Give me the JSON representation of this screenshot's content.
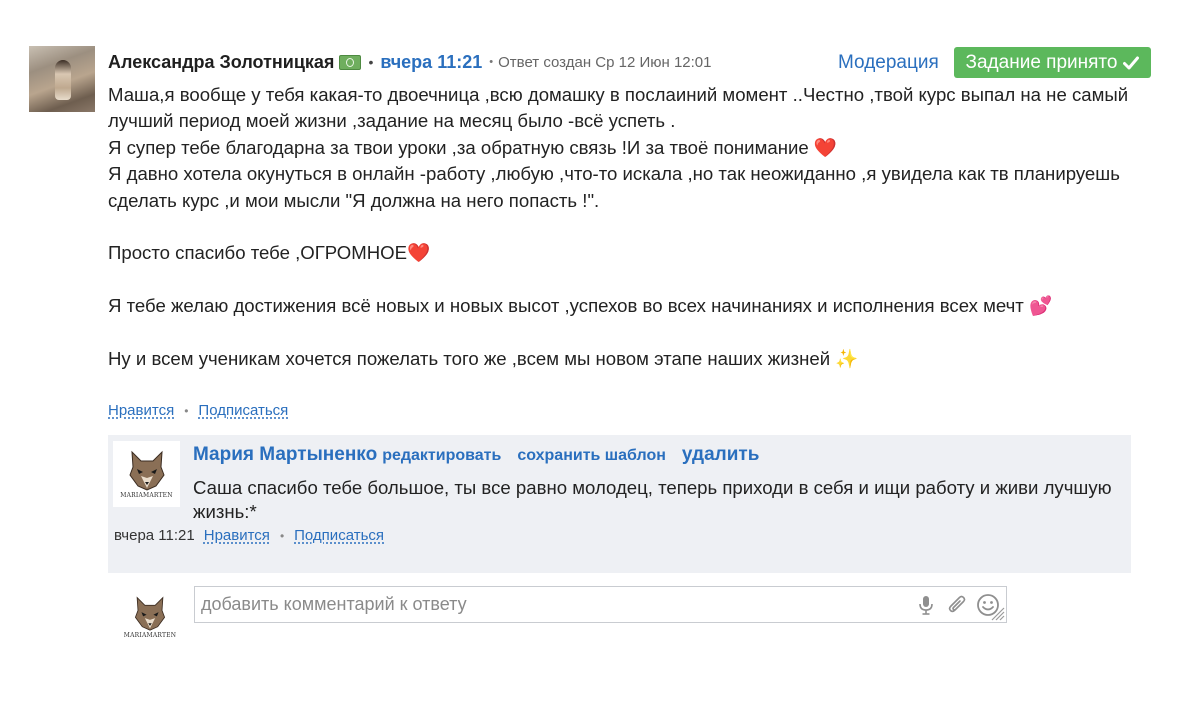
{
  "post": {
    "author": "Александра Золотницкая",
    "time": "вчера 11:21",
    "created": "Ответ создан Ср 12 Июн 12:01",
    "moderation_label": "Модерация",
    "accepted_label": "Задание принято",
    "paragraphs": [
      "Маша,я вообще у тебя какая-то двоечница ,всю домашку в послаиний момент ..Честно ,твой курс выпал на не самый лучший период моей жизни ,задание на месяц было -всё успеть .",
      "Я супер тебе благодарна за твои уроки ,за обратную связь !И за твоё понимание ❤️",
      "Я давно хотела окунуться в онлайн -работу ,любую ,что-то искала ,но так неожиданно ,я увидела как тв планируешь сделать курс ,и мои мысли \"Я должна на него попасть !\".",
      "",
      "Просто спасибо тебе ,ОГРОМНОЕ❤️",
      "",
      "Я тебе желаю достижения всё новых и новых высот ,успехов во всех начинаниях и исполнения всех мечт 💕",
      "",
      "Ну и всем ученикам хочется пожелать того же ,всем мы новом этапе наших жизней ✨"
    ],
    "like_label": "Нравится",
    "subscribe_label": "Подписаться"
  },
  "reply": {
    "author": "Мария Мартыненко",
    "edit_label": "редактировать",
    "save_template_label": "сохранить шаблон",
    "delete_label": "удалить",
    "text": "Саша спасибо тебе большое, ты все равно молодец, теперь приходи в себя и ищи работу и живи лучшую жизнь:*",
    "time": "вчера 11:21",
    "like_label": "Нравится",
    "subscribe_label": "Подписаться",
    "logo_text": "MARIAMARTEN"
  },
  "comment_box": {
    "placeholder": "добавить комментарий к ответу",
    "logo_text": "MARIAMARTEN"
  },
  "colors": {
    "link": "#2a6fbe",
    "accepted_bg": "#5cb85c",
    "reply_bg": "#eef0f4"
  },
  "icons": [
    "money-icon",
    "check-icon",
    "wolf-logo-icon",
    "microphone-icon",
    "paperclip-icon",
    "smiley-icon",
    "resize-grip-icon"
  ]
}
